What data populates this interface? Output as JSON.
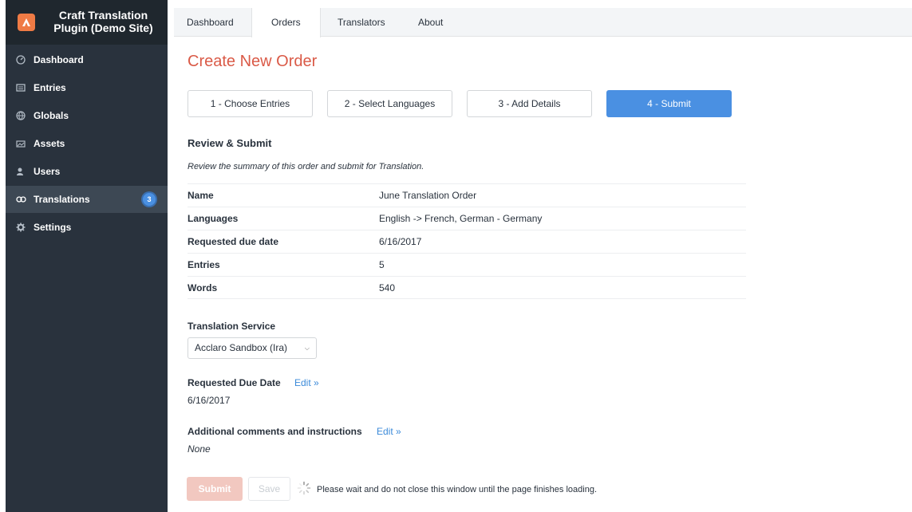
{
  "site": {
    "name_line1": "Craft Translation",
    "name_line2": "Plugin (Demo Site)"
  },
  "sidebar": {
    "items": [
      {
        "label": "Dashboard",
        "icon": "dashboard-icon"
      },
      {
        "label": "Entries",
        "icon": "entries-icon"
      },
      {
        "label": "Globals",
        "icon": "globe-icon"
      },
      {
        "label": "Assets",
        "icon": "assets-icon"
      },
      {
        "label": "Users",
        "icon": "users-icon"
      },
      {
        "label": "Translations",
        "icon": "translations-icon",
        "badge": "3",
        "selected": true
      },
      {
        "label": "Settings",
        "icon": "gear-icon"
      }
    ]
  },
  "tabs": [
    {
      "label": "Dashboard"
    },
    {
      "label": "Orders",
      "selected": true
    },
    {
      "label": "Translators"
    },
    {
      "label": "About"
    }
  ],
  "page": {
    "title": "Create New Order"
  },
  "steps": [
    {
      "label": "1 - Choose Entries"
    },
    {
      "label": "2 - Select Languages"
    },
    {
      "label": "3 - Add Details"
    },
    {
      "label": "4 - Submit",
      "active": true
    }
  ],
  "review": {
    "heading": "Review & Submit",
    "note": "Review the summary of this order and submit for Translation.",
    "rows": [
      {
        "label": "Name",
        "value": "June Translation Order"
      },
      {
        "label": "Languages",
        "value": "English -> French, German - Germany"
      },
      {
        "label": "Requested due date",
        "value": "6/16/2017"
      },
      {
        "label": "Entries",
        "value": "5"
      },
      {
        "label": "Words",
        "value": "540"
      }
    ]
  },
  "translation_service": {
    "label": "Translation Service",
    "selected": "Acclaro Sandbox (Ira)"
  },
  "due_date": {
    "label": "Requested Due Date",
    "edit": "Edit »",
    "value": "6/16/2017"
  },
  "comments": {
    "label": "Additional comments and instructions",
    "edit": "Edit »",
    "value": "None"
  },
  "actions": {
    "submit": "Submit",
    "save": "Save",
    "loading_note": "Please wait and do not close this window until the page finishes loading."
  },
  "colors": {
    "accent": "#4a90e2",
    "title": "#da5a47",
    "sidebar": "#29323d",
    "link": "#3b8ad9"
  }
}
